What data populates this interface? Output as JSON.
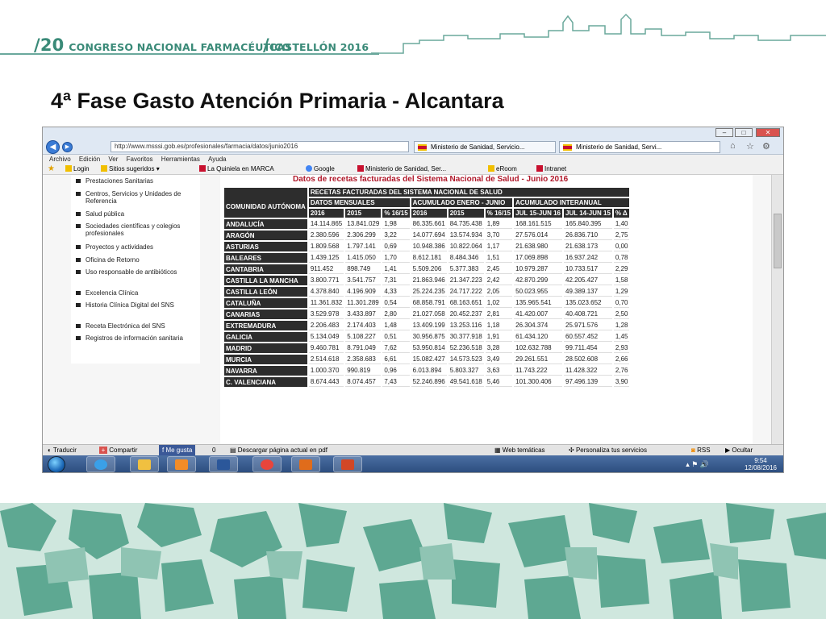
{
  "header": {
    "left_num": "/20",
    "left_text": "CONGRESO NACIONAL FARMACÉUTICO",
    "right_prefix": "/",
    "right_text": "CASTELLÓN 2016"
  },
  "slide_title": "4ª Fase Gasto Atención Primaria - Alcantara",
  "browser": {
    "url": "http://www.msssi.gob.es/profesionales/farmacia/datos/junio2016",
    "tabs": [
      {
        "label": "Ministerio de Sanidad, Servicio..."
      },
      {
        "label": "Ministerio de Sanidad, Servi..."
      }
    ],
    "menu": [
      "Archivo",
      "Edición",
      "Ver",
      "Favoritos",
      "Herramientas",
      "Ayuda"
    ],
    "favorites": [
      "Login",
      "Sitios sugeridos ▾",
      "La Quiniela en MARCA",
      "Google",
      "Ministerio de Sanidad, Ser...",
      "eRoom",
      "Intranet"
    ],
    "left_menu": [
      "Prestaciones Sanitarias",
      "Centros, Servicios y Unidades de Referencia",
      "Salud pública",
      "Sociedades científicas y colegios profesionales",
      "Proyectos y actividades",
      "Oficina de Retorno",
      "Uso responsable de antibióticos",
      "Excelencia Clínica",
      "Historia Clínica Digital del SNS",
      "Receta Electrónica del SNS",
      "Registros de información sanitaria"
    ],
    "status": {
      "translate": "Traducir",
      "share": "Compartir",
      "like": "Me gusta",
      "like_count": "0",
      "download": "Descargar página actual en pdf",
      "web_themes": "Web temáticas",
      "personalize": "Personaliza tus servicios",
      "rss": "RSS",
      "hide": "Ocultar"
    },
    "clock_time": "9:54",
    "clock_date": "12/08/2016"
  },
  "table": {
    "title": "Datos de recetas facturadas del Sistema Nacional de Salud - Junio 2016",
    "header_main": "RECETAS FACTURADAS DEL SISTEMA NACIONAL DE SALUD",
    "header_region": "COMUNIDAD AUTÓNOMA",
    "group_monthly": "DATOS MENSUALES",
    "group_ytd": "ACUMULADO ENERO - JUNIO",
    "group_annual": "ACUMULADO INTERANUAL",
    "cols": [
      "2016",
      "2015",
      "% 16/15",
      "2016",
      "2015",
      "% 16/15",
      "JUL 15-JUN 16",
      "JUL 14-JUN 15",
      "% Δ"
    ],
    "rows": [
      [
        "ANDALUCÍA",
        "14.114.865",
        "13.841.029",
        "1,98",
        "86.335.661",
        "84.735.438",
        "1,89",
        "168.161.515",
        "165.840.395",
        "1,40"
      ],
      [
        "ARAGÓN",
        "2.380.596",
        "2.306.299",
        "3,22",
        "14.077.694",
        "13.574.934",
        "3,70",
        "27.576.014",
        "26.836.710",
        "2,75"
      ],
      [
        "ASTURIAS",
        "1.809.568",
        "1.797.141",
        "0,69",
        "10.948.386",
        "10.822.064",
        "1,17",
        "21.638.980",
        "21.638.173",
        "0,00"
      ],
      [
        "BALEARES",
        "1.439.125",
        "1.415.050",
        "1,70",
        "8.612.181",
        "8.484.346",
        "1,51",
        "17.069.898",
        "16.937.242",
        "0,78"
      ],
      [
        "CANTABRIA",
        "911.452",
        "898.749",
        "1,41",
        "5.509.206",
        "5.377.383",
        "2,45",
        "10.979.287",
        "10.733.517",
        "2,29"
      ],
      [
        "CASTILLA LA MANCHA",
        "3.800.771",
        "3.541.757",
        "7,31",
        "21.863.946",
        "21.347.223",
        "2,42",
        "42.870.299",
        "42.205.427",
        "1,58"
      ],
      [
        "CASTILLA LEÓN",
        "4.378.840",
        "4.196.909",
        "4,33",
        "25.224.235",
        "24.717.222",
        "2,05",
        "50.023.955",
        "49.389.137",
        "1,29"
      ],
      [
        "CATALUÑA",
        "11.361.832",
        "11.301.289",
        "0,54",
        "68.858.791",
        "68.163.651",
        "1,02",
        "135.965.541",
        "135.023.652",
        "0,70"
      ],
      [
        "CANARIAS",
        "3.529.978",
        "3.433.897",
        "2,80",
        "21.027.058",
        "20.452.237",
        "2,81",
        "41.420.007",
        "40.408.721",
        "2,50"
      ],
      [
        "EXTREMADURA",
        "2.206.483",
        "2.174.403",
        "1,48",
        "13.409.199",
        "13.253.116",
        "1,18",
        "26.304.374",
        "25.971.576",
        "1,28"
      ],
      [
        "GALICIA",
        "5.134.049",
        "5.108.227",
        "0,51",
        "30.956.875",
        "30.377.918",
        "1,91",
        "61.434.120",
        "60.557.452",
        "1,45"
      ],
      [
        "MADRID",
        "9.460.781",
        "8.791.049",
        "7,62",
        "53.950.814",
        "52.236.518",
        "3,28",
        "102.632.788",
        "99.711.454",
        "2,93"
      ],
      [
        "MURCIA",
        "2.514.618",
        "2.358.683",
        "6,61",
        "15.082.427",
        "14.573.523",
        "3,49",
        "29.261.551",
        "28.502.608",
        "2,66"
      ],
      [
        "NAVARRA",
        "1.000.370",
        "990.819",
        "0,96",
        "6.013.894",
        "5.803.327",
        "3,63",
        "11.743.222",
        "11.428.322",
        "2,76"
      ],
      [
        "C. VALENCIANA",
        "8.674.443",
        "8.074.457",
        "7,43",
        "52.246.896",
        "49.541.618",
        "5,46",
        "101.300.406",
        "97.496.139",
        "3,90"
      ]
    ]
  },
  "colors": {
    "brand_green": "#3a8a78",
    "title_red": "#b0182a",
    "table_header": "#2d2d2d"
  }
}
